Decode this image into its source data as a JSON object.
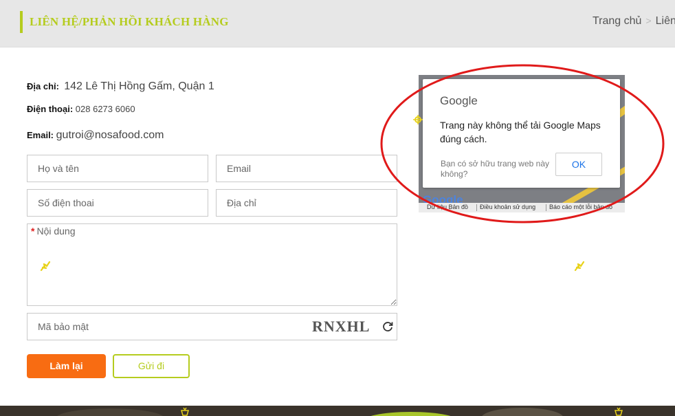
{
  "header": {
    "title": "LIÊN HỆ/PHẢN HỒI KHÁCH HÀNG",
    "breadcrumb": {
      "home": "Trang chủ",
      "current": "Liên"
    }
  },
  "contact": {
    "address_label": "Địa chỉ:",
    "address_value": "142 Lê Thị Hồng Gấm, Quận 1",
    "phone_label": "Điện thoại:",
    "phone_value": "028 6273 6060",
    "email_label": "Email:",
    "email_value": "gutroi@nosafood.com"
  },
  "form": {
    "name_placeholder": "Họ và tên",
    "email_placeholder": "Email",
    "phone_placeholder": "Số điện thoai",
    "address_placeholder": "Địa chỉ",
    "content_required_mark": "*",
    "content_label": "Nội dung",
    "captcha_placeholder": "Mã bảo mật",
    "captcha_code": "RNXHL",
    "reset_label": "Làm lại",
    "send_label": "Gửi đi"
  },
  "map": {
    "brand": "Google",
    "message": "Trang này không thể tải Google Maps đúng cách.",
    "owner_question": "Bạn có sở hữu trang web này không?",
    "ok_label": "OK",
    "footer_data": "Dữ liệu Bản đồ",
    "footer_terms": "Điều khoản sử dụng",
    "footer_report": "Báo cáo một lỗi bản đồ",
    "logo_text": "Google"
  },
  "colors": {
    "accent_green": "#b5cc1e",
    "accent_orange": "#f86c12",
    "annotation_red": "#e01a1a"
  }
}
